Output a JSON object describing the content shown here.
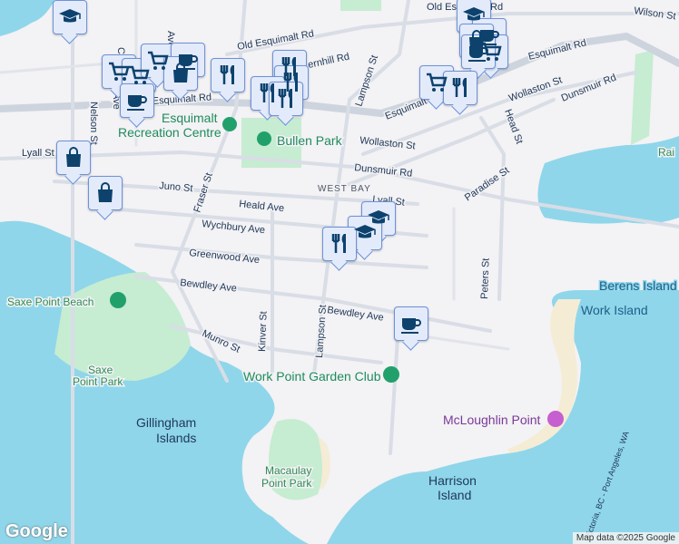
{
  "map": {
    "colors": {
      "water": "#8fd6ea",
      "land": "#f3f2f4",
      "park": "#c6ecd2",
      "marker_bg": "#e3ebfb",
      "marker_border": "#6d92d8",
      "icon": "#0d426d"
    },
    "streets": [
      {
        "name": "Old Esquimalt Rd"
      },
      {
        "name": "Old Esquimalt Rd (east)",
        "label": "Old Es     Rd"
      },
      {
        "name": "Wilson St"
      },
      {
        "name": "Esquimalt Rd"
      },
      {
        "name": "Esquimalt Rd (east)"
      },
      {
        "name": "Esquimalt Rd (center)"
      },
      {
        "name": "Wollaston St"
      },
      {
        "name": "Wollaston St (east)"
      },
      {
        "name": "Dunsmuir Rd"
      },
      {
        "name": "Dunsmuir Rd (east)"
      },
      {
        "name": "Lyall St"
      },
      {
        "name": "Lyall St (east)"
      },
      {
        "name": "Juno St"
      },
      {
        "name": "Heald Ave"
      },
      {
        "name": "Wychbury Ave"
      },
      {
        "name": "Greenwood Ave"
      },
      {
        "name": "Bewdley Ave"
      },
      {
        "name": "Bewdley Ave (east)"
      },
      {
        "name": "Munro St"
      },
      {
        "name": "Fraser St"
      },
      {
        "name": "Kinver St"
      },
      {
        "name": "Lampson St"
      },
      {
        "name": "Lampson St (north)"
      },
      {
        "name": "Nelson St"
      },
      {
        "name": "Head St"
      },
      {
        "name": "Paradise St"
      },
      {
        "name": "Peters St"
      },
      {
        "name": "Fernhill Rd",
        "label": "Fernhill Rd"
      },
      {
        "name": "Col",
        "label": "Co"
      },
      {
        "name": "Ave",
        "label": "Ave"
      },
      {
        "name": "Ave2",
        "label": "Ave"
      }
    ],
    "labels": {
      "old_esquimalt": "Old Esquimalt Rd",
      "old_es_east": "Old Es",
      "old_es_rd": "Rd",
      "wilson": "Wilson St",
      "esquimalt_w": "Esquimalt Rd",
      "esquimalt_e": "Esquimalt Rd",
      "esquimalt_c": "Esquimalt Rd",
      "wollaston_w": "Wollaston St",
      "wollaston_e": "Wollaston St",
      "dunsmuir_w": "Dunsmuir Rd",
      "dunsmuir_e": "Dunsmuir Rd",
      "lyall_w": "Lyall St",
      "lyall_e": "Lyall St",
      "juno": "Juno St",
      "heald": "Heald Ave",
      "wychbury": "Wychbury Ave",
      "greenwood": "Greenwood Ave",
      "bewdley_w": "Bewdley Ave",
      "bewdley_e": "Bewdley Ave",
      "munro": "Munro St",
      "fraser": "Fraser St",
      "kinver": "Kinver St",
      "lampson_s": "Lampson St",
      "lampson_n": "Lampson St",
      "nelson": "Nelson St",
      "head": "Head St",
      "paradise": "Paradise St",
      "peters": "Peters St",
      "fernhill": "ernhill Rd",
      "co": "Co",
      "ave1": "Ave",
      "ave2": "Ave",
      "west_bay": "WEST BAY",
      "saxe_beach": "Saxe Point Beach",
      "saxe_park_1": "Saxe",
      "saxe_park_2": "Point Park",
      "gillingham_1": "Gillingham",
      "gillingham_2": "Islands",
      "macaulay_1": "Macaulay",
      "macaulay_2": "Point Park",
      "harrison_1": "Harrison",
      "harrison_2": "Island",
      "berens": "Berens Island",
      "work_island": "Work Island",
      "rain": "Rai",
      "ferry": "Victoria, BC - Port Angeles, WA"
    },
    "pois": {
      "rec_centre_1": "Esquimalt",
      "rec_centre_2": "Recreation Centre",
      "bullen": "Bullen Park",
      "garden_club": "Work Point Garden Club",
      "mcloughlin": "McLoughlin Point"
    },
    "markers": [
      {
        "icon": "school-icon"
      },
      {
        "icon": "cart-icon"
      },
      {
        "icon": "cart-icon"
      },
      {
        "icon": "cart-icon"
      },
      {
        "icon": "coffee-icon"
      },
      {
        "icon": "bag-icon"
      },
      {
        "icon": "coffee-icon"
      },
      {
        "icon": "restaurant-icon"
      },
      {
        "icon": "restaurant-icon"
      },
      {
        "icon": "restaurant-icon"
      },
      {
        "icon": "restaurant-icon"
      },
      {
        "icon": "restaurant-icon"
      },
      {
        "icon": "bag-icon"
      },
      {
        "icon": "bag-icon"
      },
      {
        "icon": "school-icon"
      },
      {
        "icon": "coffee-icon"
      },
      {
        "icon": "bag-icon"
      },
      {
        "icon": "cart-icon"
      },
      {
        "icon": "coffee-icon"
      },
      {
        "icon": "cart-icon"
      },
      {
        "icon": "restaurant-icon"
      },
      {
        "icon": "school-icon"
      },
      {
        "icon": "school-icon"
      },
      {
        "icon": "restaurant-icon"
      },
      {
        "icon": "coffee-icon"
      }
    ]
  },
  "footer": {
    "logo": "Google",
    "attribution": "Map data ©2025 Google"
  }
}
